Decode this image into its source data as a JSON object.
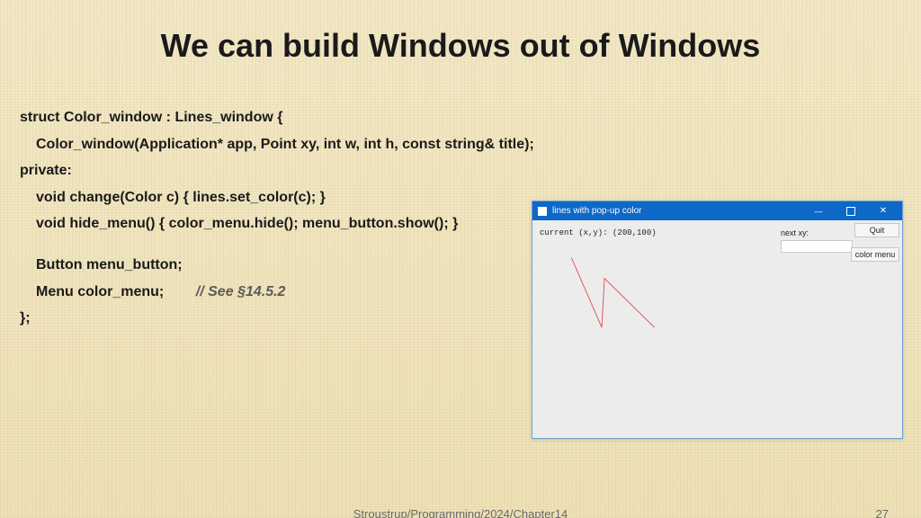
{
  "title": "We can build Windows out of Windows",
  "code": {
    "l1": "struct Color_window : Lines_window {",
    "l2": "Color_window(Application* app, Point xy, int w, int h, const string& title);",
    "l3": "private:",
    "l4": "void change(Color c) { lines.set_color(c); }",
    "l5": "void hide_menu() { color_menu.hide(); menu_button.show(); }",
    "l6": "Button menu_button;",
    "l7pre": "Menu color_menu;",
    "l7comment": "// See §14.5.2",
    "l8": "};"
  },
  "miniwin": {
    "title": "lines with pop-up color",
    "current_label": "current (x,y): (200,100)",
    "next_label": "next xy:",
    "quit": "Quit",
    "color_menu": "color menu"
  },
  "footer": {
    "source": "Stroustrup/Programming/2024/Chapter14",
    "page": "27"
  }
}
